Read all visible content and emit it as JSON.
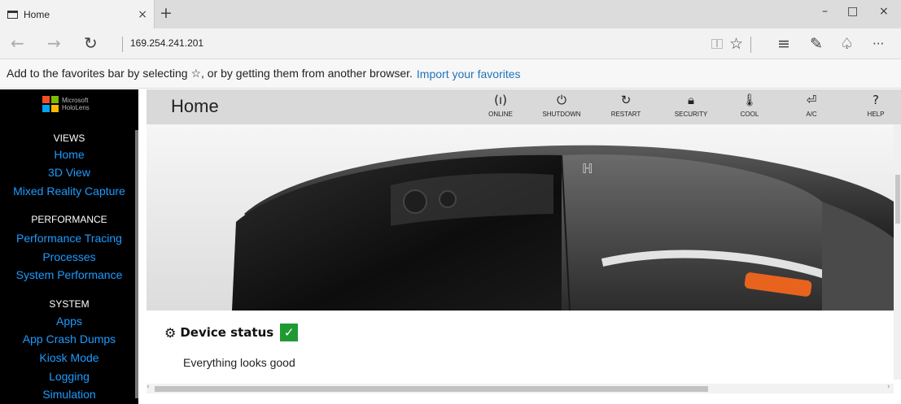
{
  "browser": {
    "tab": {
      "title": "Home",
      "close": "×"
    },
    "new_tab": "+",
    "window_controls": {
      "minimize": "–",
      "maximize": "□",
      "close": "×"
    },
    "nav": {
      "back": "←",
      "forward": "→",
      "refresh": "↻"
    },
    "url": "169.254.241.201",
    "toolbar": {
      "favorite": "☆",
      "hub": "≡",
      "note": "✎",
      "share": "♤",
      "more": "···"
    },
    "icons": [
      "page-icon",
      "close-icon",
      "plus-icon",
      "back-arrow-icon",
      "forward-arrow-icon",
      "refresh-icon",
      "reading-view-icon",
      "star-icon",
      "hub-icon",
      "web-note-icon",
      "share-icon",
      "more-icon"
    ]
  },
  "favorites_bar": {
    "text": "Add to the favorites bar by selecting ☆, or by getting them from another browser.",
    "link": "Import your favorites"
  },
  "sidebar": {
    "logo": {
      "line1": "Microsoft",
      "line2": "HoloLens",
      "colors": [
        "#f25022",
        "#7fba00",
        "#00a4ef",
        "#ffb900"
      ]
    },
    "sections": [
      {
        "title": "VIEWS",
        "items": [
          "Home",
          "3D View",
          "Mixed Reality Capture"
        ]
      },
      {
        "title": "PERFORMANCE",
        "items": [
          "Performance Tracing",
          "Processes",
          "System Performance"
        ]
      },
      {
        "title": "SYSTEM",
        "items": [
          "Apps",
          "App Crash Dumps",
          "Kiosk Mode",
          "Logging",
          "Simulation"
        ]
      }
    ],
    "link_color": "#1d9bff"
  },
  "header": {
    "title": "Home",
    "buttons": [
      {
        "label": "ONLINE",
        "icon": "(ı)"
      },
      {
        "label": "SHUTDOWN",
        "icon": "⏻"
      },
      {
        "label": "RESTART",
        "icon": "↻"
      },
      {
        "label": "SECURITY",
        "icon": "🔒︎"
      },
      {
        "label": "COOL",
        "icon": "🌡︎"
      },
      {
        "label": "A/C",
        "icon": "⏎"
      },
      {
        "label": "HELP",
        "icon": "?"
      }
    ]
  },
  "device_status": {
    "title": "Device status",
    "icon": "⚙",
    "check": "✓",
    "message": "Everything looks good",
    "status_color": "#1f9a33"
  },
  "scroll": {
    "left_arrow": "‹",
    "right_arrow": "›"
  }
}
